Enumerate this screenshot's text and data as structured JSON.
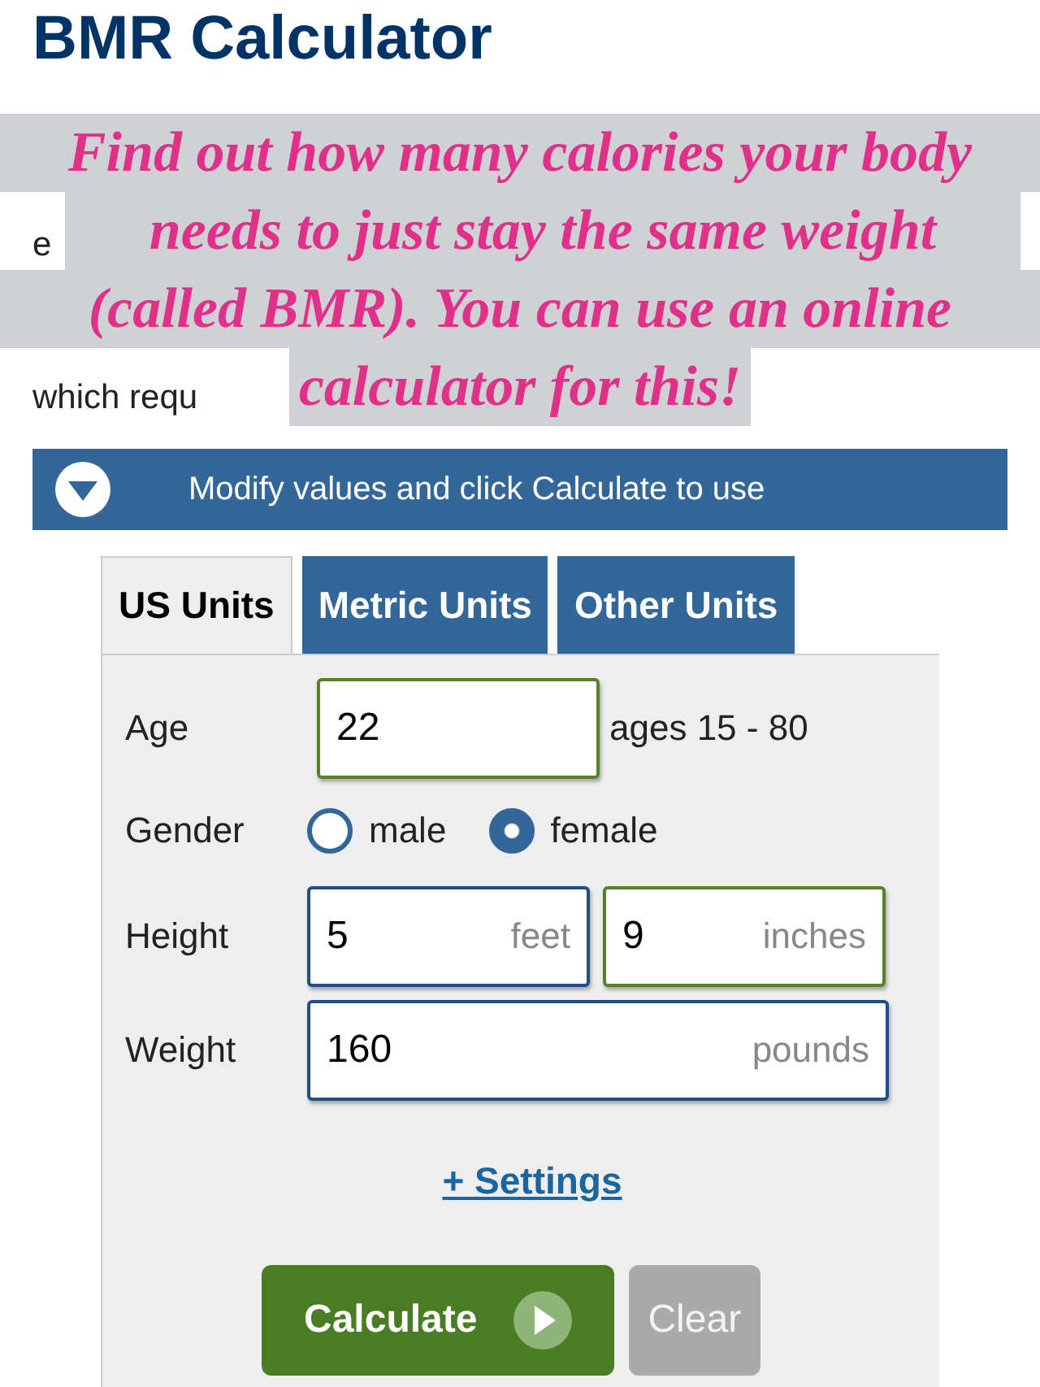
{
  "title": "BMR Calculator",
  "intro_lines": [
    "e",
    "which requ"
  ],
  "caption_lines": [
    "Find out how many calories your body",
    "needs to just stay the same weight",
    "(called BMR). You can use an online",
    "calculator for this!"
  ],
  "banner": {
    "text": "Modify values and click Calculate to use"
  },
  "tabs": [
    {
      "label": "US Units",
      "selected": true
    },
    {
      "label": "Metric Units",
      "selected": false
    },
    {
      "label": "Other Units",
      "selected": false
    }
  ],
  "form": {
    "age": {
      "label": "Age",
      "value": "22",
      "highlighted": true,
      "hint": "ages 15 - 80"
    },
    "gender": {
      "label": "Gender",
      "options": [
        {
          "label": "male",
          "selected": false
        },
        {
          "label": "female",
          "selected": true
        }
      ]
    },
    "height": {
      "label": "Height",
      "fields": [
        {
          "value": "5",
          "unit": "feet",
          "highlighted": false
        },
        {
          "value": "9",
          "unit": "inches",
          "highlighted": true
        }
      ]
    },
    "weight": {
      "label": "Weight",
      "value": "160",
      "unit": "pounds",
      "highlighted": false
    },
    "settings_link": "+ Settings",
    "buttons": [
      {
        "label": "Calculate",
        "kind": "primary"
      },
      {
        "label": "Clear",
        "kind": "secondary"
      }
    ]
  }
}
